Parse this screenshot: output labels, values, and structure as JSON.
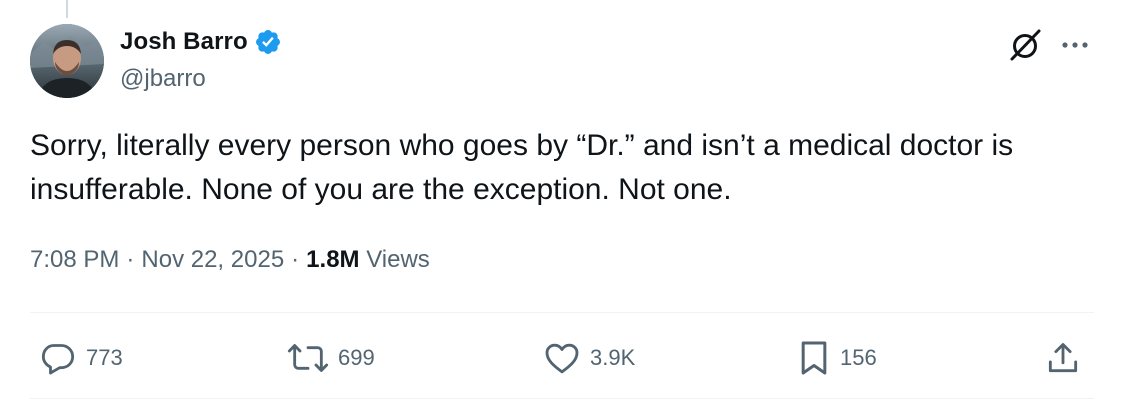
{
  "author": {
    "display_name": "Josh Barro",
    "handle": "@jbarro"
  },
  "icons": {
    "avatar": "avatar",
    "verified": "verified-badge-icon",
    "grok": "grok-icon",
    "more": "more-icon",
    "reply": "reply-icon",
    "retweet": "retweet-icon",
    "like": "like-icon",
    "bookmark": "bookmark-icon",
    "share": "share-icon"
  },
  "tweet": {
    "line1": "Sorry, literally every person who goes by “Dr.” and isn’t a medical doctor is",
    "line2": "insufferable. None of you are the exception. Not one."
  },
  "meta": {
    "time": "7:08 PM",
    "sep1": "·",
    "date": "Nov 22, 2025",
    "sep2": "·",
    "views_count": "1.8M",
    "views_label": "Views"
  },
  "stats": {
    "replies": "773",
    "retweets": "699",
    "likes": "3.9K",
    "bookmarks": "156"
  },
  "colors": {
    "text": "#0f1419",
    "secondary": "#536471",
    "verified": "#1d9bf0",
    "divider": "#eff3f4"
  }
}
